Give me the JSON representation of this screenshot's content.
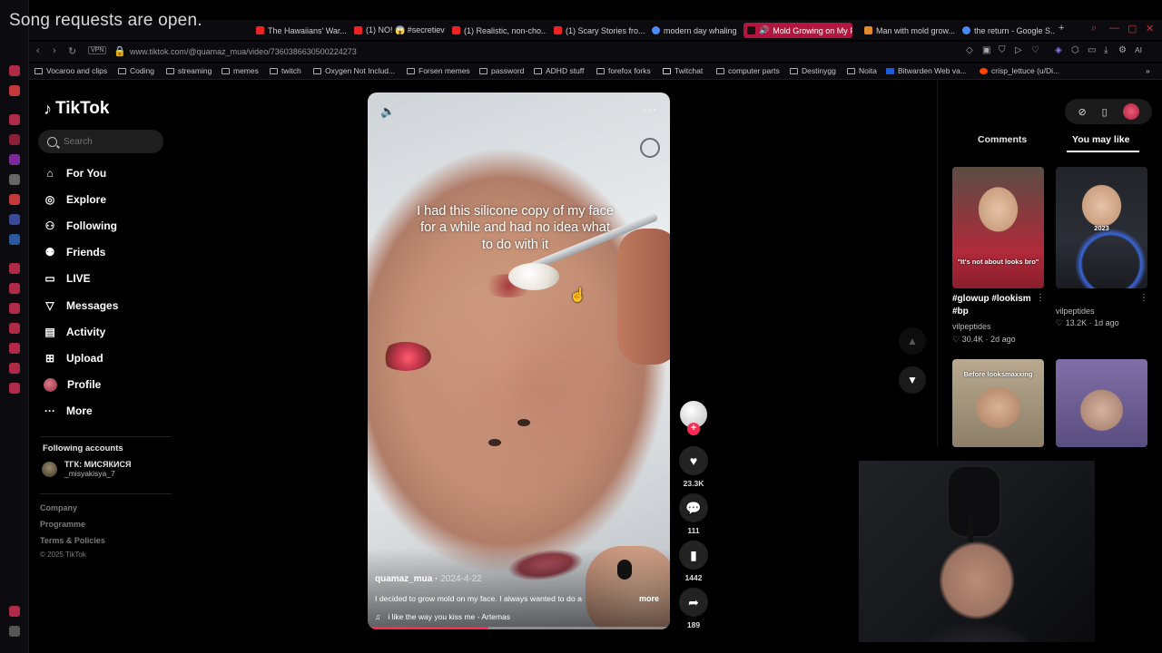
{
  "overlay": {
    "text": "Song requests are open."
  },
  "browser": {
    "tabs": [
      {
        "label": "The Hawaiians' War..."
      },
      {
        "label": "(1) NO! 😱 #secretiev..."
      },
      {
        "label": "(1) Realistic, non-cho..."
      },
      {
        "label": "(1) Scary Stories fro..."
      },
      {
        "label": "modern day whaling"
      },
      {
        "label": "Mold Growing on My F..."
      },
      {
        "label": "Man with mold grow..."
      },
      {
        "label": "the return - Google S..."
      }
    ],
    "new_tab": "+",
    "url": "www.tiktok.com/@quamaz_mua/video/7360386630500224273",
    "vpn_label": "VPN",
    "ai_label": "AI",
    "bookmarks": [
      "Vocaroo and clips",
      "Coding",
      "streaming",
      "memes",
      "twitch",
      "Oxygen Not Includ...",
      "Forsen memes",
      "password",
      "ADHD stuff",
      "forefox forks",
      "Twitchat",
      "computer parts",
      "Destinygg",
      "Noita",
      "Bitwarden Web va...",
      "crisp_lettuce (u/Di..."
    ],
    "colors": {
      "accent": "#b2163e",
      "chrome": "#0c0c10"
    }
  },
  "tiktok": {
    "logo": "TikTok",
    "search_placeholder": "Search",
    "nav": [
      {
        "label": "For You",
        "icon": "home-icon"
      },
      {
        "label": "Explore",
        "icon": "compass-icon"
      },
      {
        "label": "Following",
        "icon": "person-follow-icon"
      },
      {
        "label": "Friends",
        "icon": "friends-icon"
      },
      {
        "label": "LIVE",
        "icon": "tv-icon"
      },
      {
        "label": "Messages",
        "icon": "send-icon"
      },
      {
        "label": "Activity",
        "icon": "inbox-icon"
      },
      {
        "label": "Upload",
        "icon": "plus-square-icon"
      },
      {
        "label": "Profile",
        "icon": "avatar"
      },
      {
        "label": "More",
        "icon": "more-dots-icon"
      }
    ],
    "following_accounts_title": "Following accounts",
    "following_account": {
      "name": "ТГК: МИСЯКИСЯ",
      "handle": "_misyakisya_7"
    },
    "footer_links": [
      "Company",
      "Programme",
      "Terms & Policies"
    ],
    "copyright": "© 2025 TikTok",
    "video": {
      "caption": "I had this silicone copy of my face for a while and had no idea what to do with it",
      "author": "quamaz_mua",
      "date": "2024-4-22",
      "description": "I decided to grow mold on my face. I always wanted to do a",
      "more_label": "more",
      "music": "i like the way you kiss me - Artemas",
      "progress_fraction": 0.4
    },
    "actions": {
      "likes": "23.3K",
      "comments": "111",
      "saves": "1442",
      "shares": "189"
    },
    "right_panel": {
      "tab_comments": "Comments",
      "tab_you_may_like": "You may like",
      "recommendations": [
        {
          "thumb_text": "\"It's not about looks bro\"",
          "title": "#glowup #lookism #bp",
          "author": "vilpeptides",
          "likes": "30.4K",
          "age": "2d ago"
        },
        {
          "thumb_text": "2023",
          "title": "",
          "author": "vilpeptides",
          "likes": "13.2K",
          "age": "1d ago"
        },
        {
          "thumb_text": "Before looksmaxxing",
          "title": "",
          "author": "",
          "likes": "",
          "age": ""
        },
        {
          "thumb_text": "",
          "title": "",
          "author": "",
          "likes": "",
          "age": ""
        }
      ]
    },
    "colors": {
      "brand_red": "#fe2c55"
    }
  }
}
